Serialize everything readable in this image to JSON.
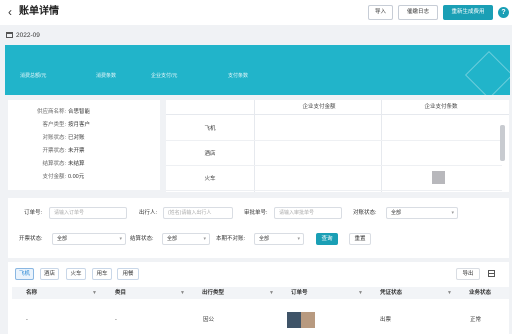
{
  "header": {
    "back_icon": "chevron-left-icon",
    "title": "账单详情",
    "import_label": "导入",
    "log_label": "催缴日志",
    "regen_label": "重新生成费用",
    "help_glyph": "?"
  },
  "period": {
    "icon": "calendar-icon",
    "label": "2022-09"
  },
  "banner": {
    "color": "#21b4ca",
    "stats": [
      "消费总额/元",
      "消费条数",
      "企业支付/元",
      "支付条数"
    ]
  },
  "info": {
    "rows": [
      {
        "key": "供应商名称:",
        "value": "合思智能"
      },
      {
        "key": "客户类型:",
        "value": "按月客户"
      },
      {
        "key": "对账状态:",
        "value": "已对账"
      },
      {
        "key": "开票状态:",
        "value": "未开票"
      },
      {
        "key": "结算状态:",
        "value": "未结算"
      },
      {
        "key": "支付金额:",
        "value": "0.00元"
      }
    ]
  },
  "stats_table": {
    "headers": [
      "企业支付金额",
      "企业支付条数"
    ],
    "rows": [
      "飞机",
      "酒店",
      "火车"
    ]
  },
  "filters": {
    "order_no_label": "订单号:",
    "order_no_placeholder": "请输入订单号",
    "traveler_label": "出行人:",
    "traveler_placeholder": "(姓名)请输入出行人",
    "approval_label": "审批单号:",
    "approval_placeholder": "请输入审批单号",
    "check_status_label": "对账状态:",
    "check_status_value": "全部",
    "invoice_label": "开票状态:",
    "invoice_value": "全部",
    "settle_label": "结算状态:",
    "settle_value": "全部",
    "mismatch_label": "本期不对账:",
    "mismatch_value": "全部",
    "query_label": "查询",
    "reset_label": "重置"
  },
  "tabs": [
    "飞机",
    "酒店",
    "火车",
    "用车",
    "用餐"
  ],
  "export_label": "导出",
  "table": {
    "columns": [
      "名称",
      "类目",
      "出行类型",
      "订单号",
      "凭证状态",
      "业务状态"
    ],
    "row": {
      "name": "-",
      "category": "-",
      "travel_type": "因公",
      "voucher_status": "出票",
      "business_status": "正常"
    }
  }
}
